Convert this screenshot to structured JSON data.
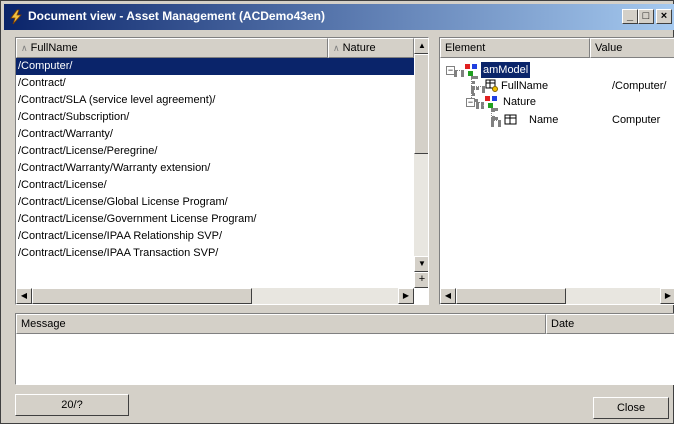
{
  "window": {
    "title": "Document view - Asset Management (ACDemo43en)",
    "minimize": "_",
    "maximize": "□",
    "close": "×"
  },
  "left_list": {
    "columns": [
      "FullName",
      "Nature"
    ],
    "rows": [
      "/Computer/",
      "/Contract/",
      "/Contract/SLA (service level agreement)/",
      "/Contract/Subscription/",
      "/Contract/Warranty/",
      "/Contract/License/Peregrine/",
      "/Contract/Warranty/Warranty extension/",
      "/Contract/License/",
      "/Contract/License/Global License Program/",
      "/Contract/License/Government License Program/",
      "/Contract/License/IPAA Relationship SVP/",
      "/Contract/License/IPAA Transaction SVP/"
    ],
    "selected_index": 0
  },
  "right_tree": {
    "columns": [
      "Element",
      "Value"
    ],
    "nodes": [
      {
        "label": "amModel",
        "value": ""
      },
      {
        "label": "FullName",
        "value": "/Computer/"
      },
      {
        "label": "Nature",
        "value": ""
      },
      {
        "label": "Name",
        "value": "Computer"
      }
    ]
  },
  "messages": {
    "columns": [
      "Message",
      "Date"
    ]
  },
  "footer": {
    "counter": "20/?",
    "close_label": "Close"
  }
}
